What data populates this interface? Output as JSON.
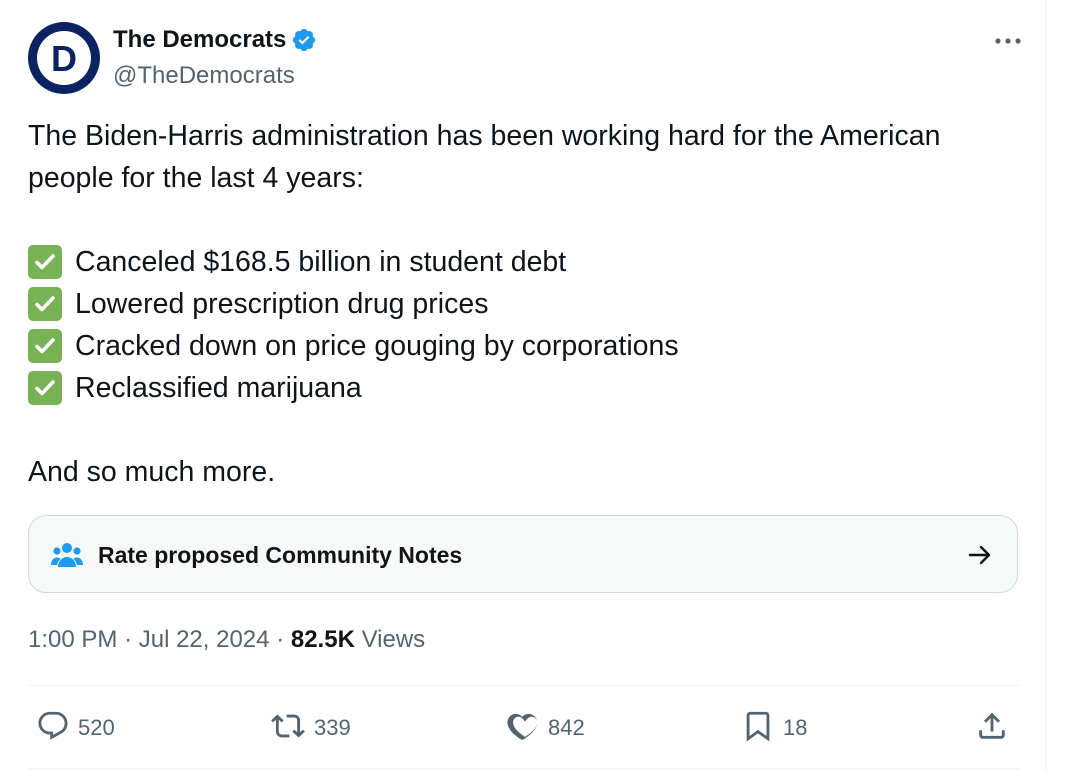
{
  "author": {
    "display_name": "The Democrats",
    "handle": "@TheDemocrats",
    "avatar_letter": "D",
    "verified": true
  },
  "tweet": {
    "intro": "The Biden-Harris administration has been working hard for the American people for the last 4 years:",
    "items": [
      "Canceled $168.5 billion in student debt",
      "Lowered prescription drug prices",
      "Cracked down on price gouging by corporations",
      "Reclassified marijuana"
    ],
    "closing": "And so much more."
  },
  "community_notes": {
    "label": "Rate proposed Community Notes"
  },
  "meta": {
    "time": "1:00 PM",
    "separator": "·",
    "date": "Jul 22, 2024",
    "views_count": "82.5K",
    "views_label": "Views"
  },
  "actions": {
    "replies": "520",
    "reposts": "339",
    "likes": "842",
    "bookmarks": "18"
  },
  "colors": {
    "brand_blue": "#0a2463",
    "verified_blue": "#1d9bf0",
    "check_green": "#77b255",
    "text_secondary": "#536471"
  },
  "icons": {
    "more": "more-dots-icon",
    "verified": "verified-badge-icon",
    "check": "check-mark-icon",
    "notes": "community-notes-people-icon",
    "arrow": "arrow-right-icon",
    "reply": "reply-icon",
    "repost": "repost-icon",
    "like": "heart-icon",
    "bookmark": "bookmark-icon",
    "share": "share-icon"
  }
}
